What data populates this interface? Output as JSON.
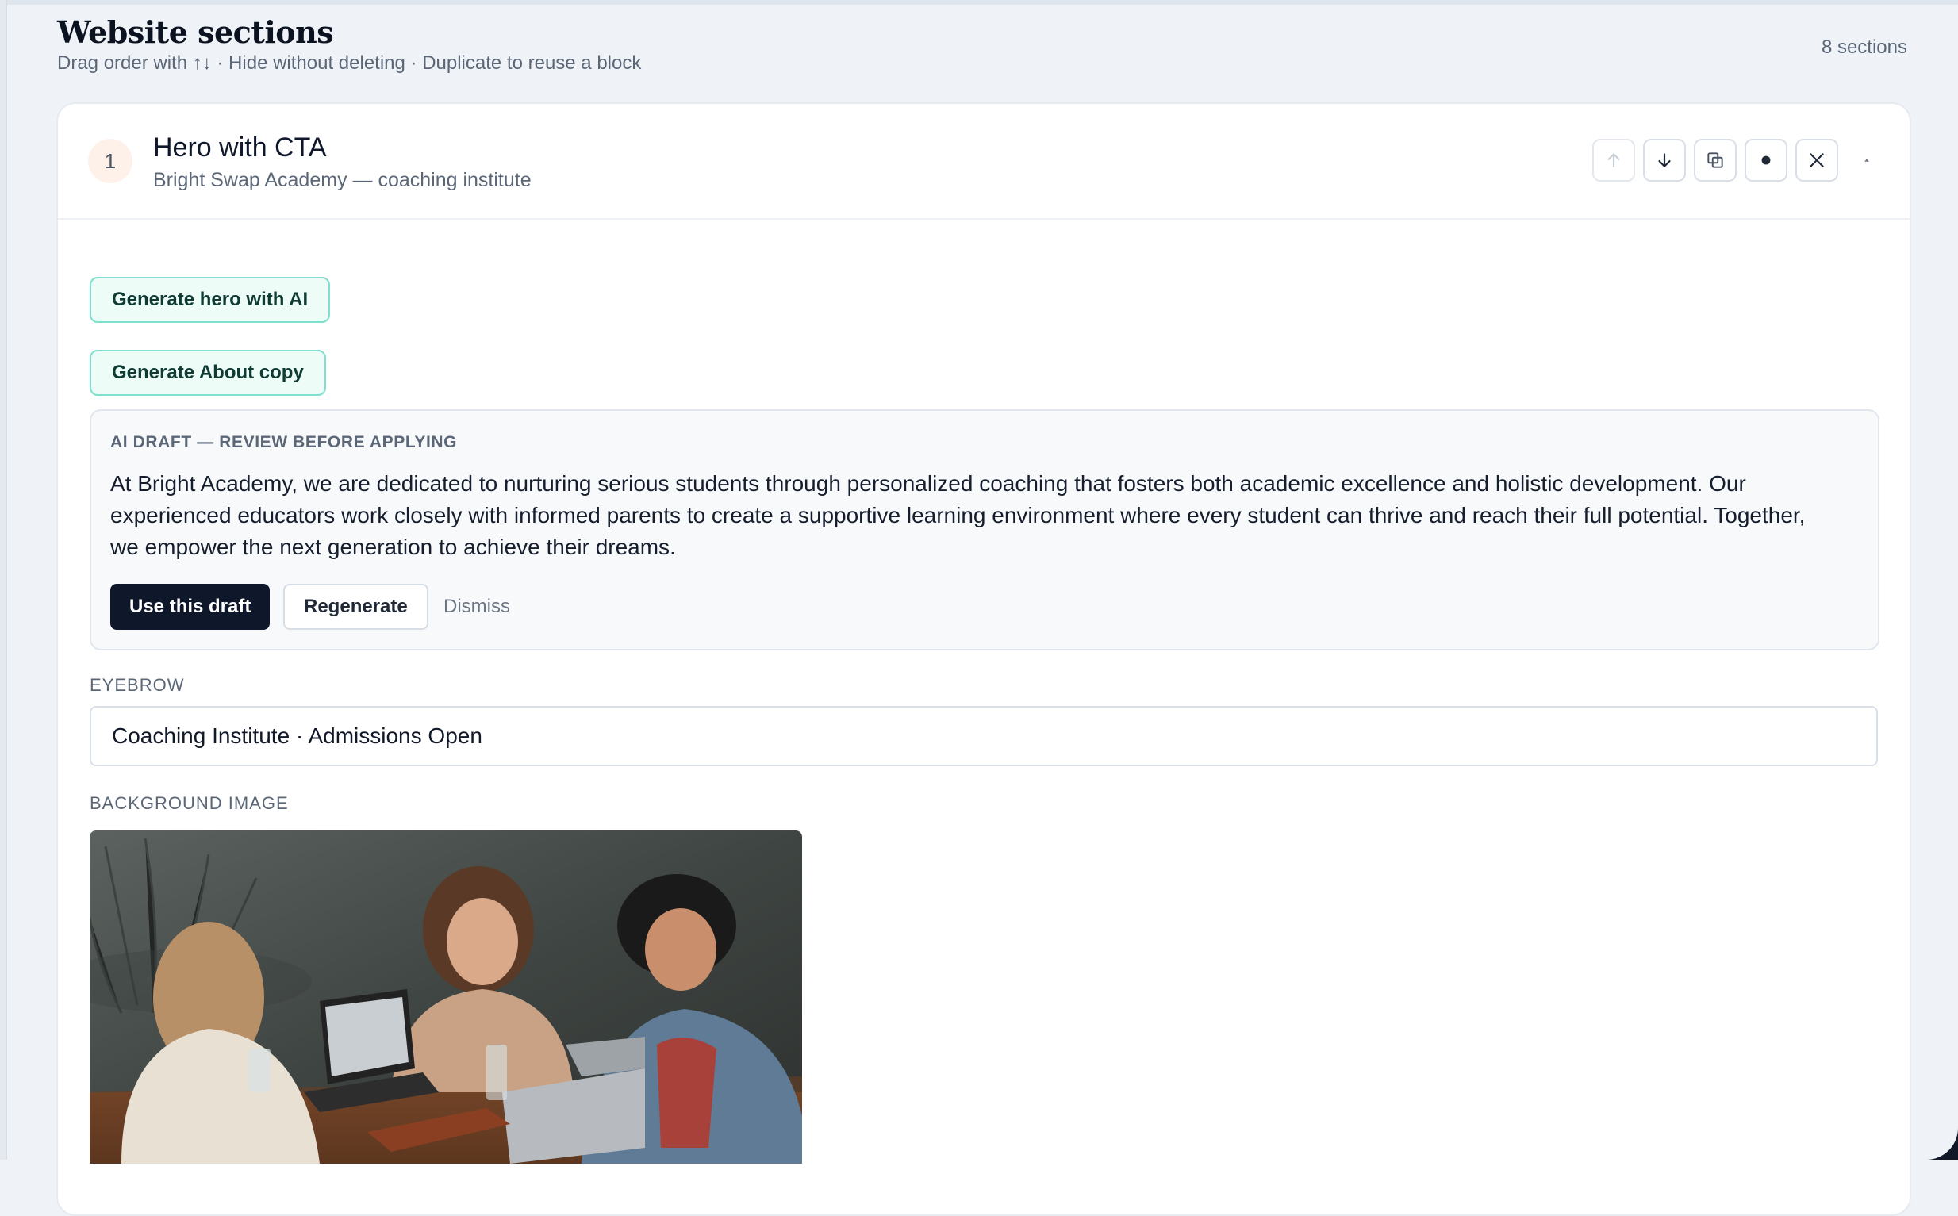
{
  "header": {
    "title": "Website sections",
    "subtitle": "Drag order with ↑↓ · Hide without deleting · Duplicate to reuse a block",
    "count": "8 sections"
  },
  "section": {
    "number": "1",
    "title": "Hero with CTA",
    "subtitle": "Bright Swap Academy — coaching institute",
    "tools": [
      "arrow-up-icon",
      "arrow-down-icon",
      "duplicate-icon",
      "dot-icon",
      "close-icon",
      "caret-up-icon"
    ]
  },
  "ai": {
    "hero_button": "Generate hero with AI",
    "about_button": "Generate About copy"
  },
  "draft": {
    "label": "AI DRAFT — REVIEW BEFORE APPLYING",
    "text": "At Bright Academy, we are dedicated to nurturing serious students through personalized coaching that fosters both academic excellence and holistic development. Our experienced educators work closely with informed parents to create a supportive learning environment where every student can thrive and reach their full potential. Together, we empower the next generation to achieve their dreams.",
    "use_label": "Use this draft",
    "regenerate_label": "Regenerate",
    "dismiss_label": "Dismiss"
  },
  "fields": {
    "eyebrow_label": "EYEBROW",
    "eyebrow_value": "Coaching Institute · Admissions Open",
    "background_label": "BACKGROUND IMAGE"
  },
  "colors": {
    "accent_border": "#7fe0cd",
    "accent_bg": "#eefcf8",
    "primary_button": "#0f172a"
  }
}
